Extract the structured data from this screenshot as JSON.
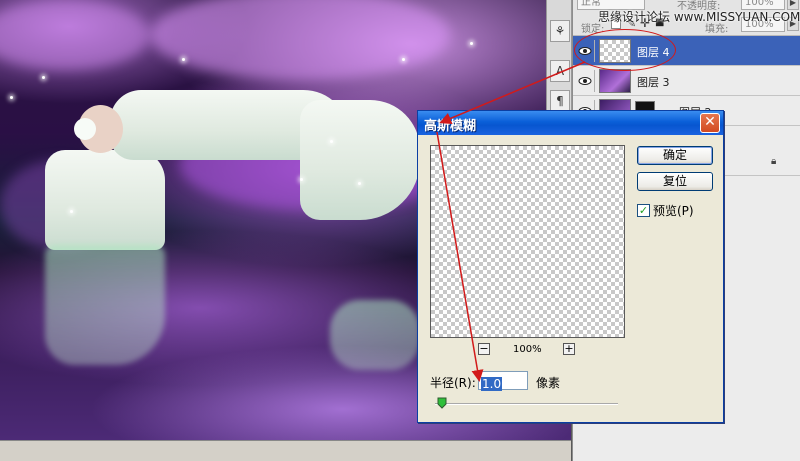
{
  "watermark": "思缘设计论坛 www.MISSYUAN.COM",
  "layers_panel": {
    "blend_mode": "正常",
    "opacity_label": "不透明度:",
    "opacity_value": "100%",
    "lock_label": "锁定:",
    "fill_label": "填充:",
    "fill_value": "100%",
    "layers": [
      {
        "name": "图层 4",
        "selected": true,
        "thumbnail": "transparent"
      },
      {
        "name": "图层 3",
        "selected": false,
        "thumbnail": "image"
      },
      {
        "name": "图层 2",
        "selected": false,
        "thumbnail": "image-with-mask"
      }
    ]
  },
  "dialog": {
    "title": "高斯模糊",
    "ok_label": "确定",
    "reset_label": "复位",
    "preview_label": "预览(P)",
    "preview_checked": true,
    "zoom_out_label": "−",
    "zoom_in_label": "+",
    "zoom_level": "100%",
    "radius_label": "半径(R):",
    "radius_value": "1.0",
    "unit_label": "像素"
  },
  "icons": {
    "eye": "eye-icon",
    "close": "close-icon",
    "lock": "lock-icon",
    "type_tool": "type-tool-icon",
    "tool_top": "tool-icon"
  },
  "colors": {
    "selected_layer": "#3b62b8",
    "dialog_titlebar": "#0a5fd8",
    "annotation_red": "#d21a1a"
  }
}
